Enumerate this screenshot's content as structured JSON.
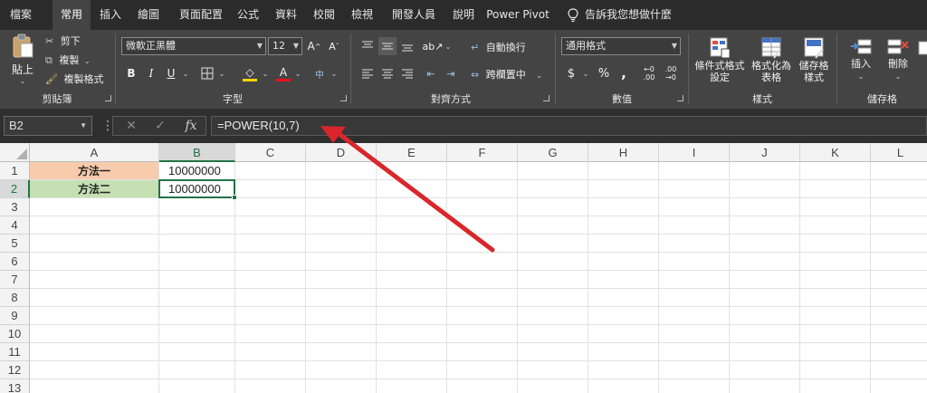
{
  "menu": {
    "tabs": [
      {
        "label": "檔案"
      },
      {
        "label": "常用"
      },
      {
        "label": "插入"
      },
      {
        "label": "繪圖"
      },
      {
        "label": "頁面配置"
      },
      {
        "label": "公式"
      },
      {
        "label": "資料"
      },
      {
        "label": "校閱"
      },
      {
        "label": "檢視"
      },
      {
        "label": "開發人員"
      },
      {
        "label": "說明"
      },
      {
        "label": "Power Pivot"
      }
    ],
    "active_tab": "常用",
    "tell_me": "告訴我您想做什麼"
  },
  "ribbon": {
    "clipboard": {
      "group_label": "剪貼簿",
      "paste": "貼上",
      "cut": "剪下",
      "copy": "複製",
      "format_painter": "複製格式"
    },
    "font": {
      "group_label": "字型",
      "font_name": "微軟正黑體",
      "font_size": "12",
      "bold": "B",
      "italic": "I",
      "underline": "U",
      "font_color": "#e81123",
      "fill_color": "#ffd400"
    },
    "alignment": {
      "group_label": "對齊方式",
      "wrap_text": "自動換行",
      "merge_center": "跨欄置中"
    },
    "number": {
      "group_label": "數值",
      "format": "通用格式",
      "currency": "$",
      "percent": "%",
      "comma": ",",
      "inc_decimal": ".00",
      "dec_decimal": ".00"
    },
    "styles": {
      "group_label": "樣式",
      "conditional": [
        "條件式格式",
        "設定"
      ],
      "as_table": [
        "格式化為",
        "表格"
      ],
      "cell_styles": [
        "儲存格",
        "樣式"
      ]
    },
    "cells": {
      "group_label": "儲存格",
      "insert": "插入",
      "delete": "刪除"
    }
  },
  "formula_bar": {
    "name_box": "B2",
    "cancel": "✕",
    "enter": "✓",
    "fx": "fx",
    "formula": "=POWER(10,7)"
  },
  "sheet": {
    "columns": [
      "A",
      "B",
      "C",
      "D",
      "E",
      "F",
      "G",
      "H",
      "I",
      "J",
      "K",
      "L"
    ],
    "rows": [
      "1",
      "2",
      "3",
      "4",
      "5",
      "6",
      "7",
      "8",
      "9",
      "10",
      "11",
      "12",
      "13"
    ],
    "selected_cell": "B2",
    "cells": {
      "A1": "方法一",
      "B1": "10000000",
      "A2": "方法二",
      "B2": "10000000"
    },
    "fills": {
      "A1": "#f8cbad",
      "A2": "#c6e0b4"
    }
  },
  "annotation": {
    "arrow_color": "#d9262b"
  }
}
